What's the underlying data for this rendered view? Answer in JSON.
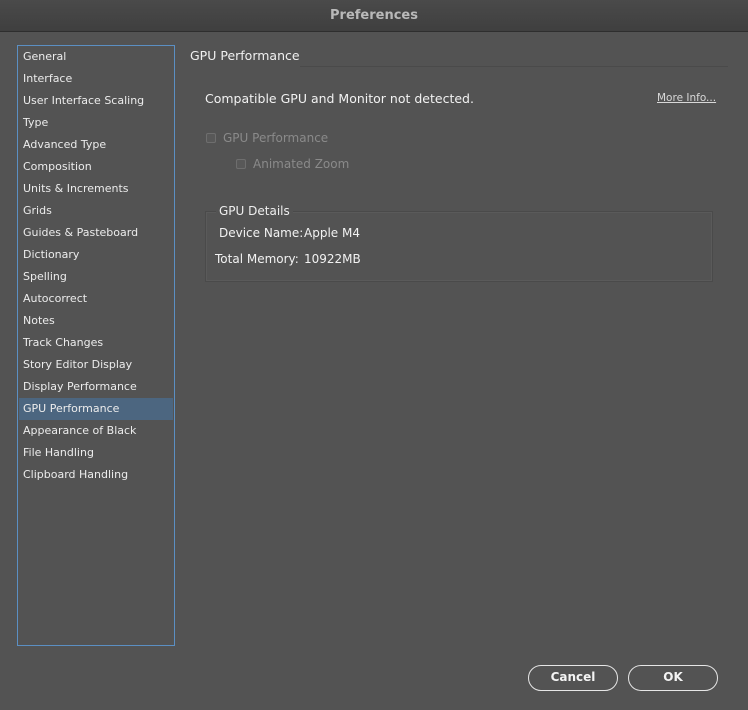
{
  "window": {
    "title": "Preferences"
  },
  "sidebar": {
    "selected_index": 16,
    "items": [
      {
        "label": "General"
      },
      {
        "label": "Interface"
      },
      {
        "label": "User Interface Scaling"
      },
      {
        "label": "Type"
      },
      {
        "label": "Advanced Type"
      },
      {
        "label": "Composition"
      },
      {
        "label": "Units & Increments"
      },
      {
        "label": "Grids"
      },
      {
        "label": "Guides & Pasteboard"
      },
      {
        "label": "Dictionary"
      },
      {
        "label": "Spelling"
      },
      {
        "label": "Autocorrect"
      },
      {
        "label": "Notes"
      },
      {
        "label": "Track Changes"
      },
      {
        "label": "Story Editor Display"
      },
      {
        "label": "Display Performance"
      },
      {
        "label": "GPU Performance"
      },
      {
        "label": "Appearance of Black"
      },
      {
        "label": "File Handling"
      },
      {
        "label": "Clipboard Handling"
      }
    ]
  },
  "main": {
    "section_title": "GPU Performance",
    "notice": "Compatible GPU and Monitor not detected.",
    "more_info_label": "More Info...",
    "gpu_performance_checkbox": {
      "label": "GPU Performance",
      "checked": false,
      "enabled": false
    },
    "animated_zoom_checkbox": {
      "label": "Animated Zoom",
      "checked": false,
      "enabled": false
    },
    "gpu_details": {
      "legend": "GPU Details",
      "device_name_label": "Device Name:",
      "device_name_value": "Apple M4",
      "total_memory_label": "Total Memory:",
      "total_memory_value": "10922MB"
    }
  },
  "footer": {
    "cancel_label": "Cancel",
    "ok_label": "OK"
  },
  "colors": {
    "background": "#535353",
    "sidebar_border": "#5b8fc3",
    "selected_item": "#4c6680"
  }
}
